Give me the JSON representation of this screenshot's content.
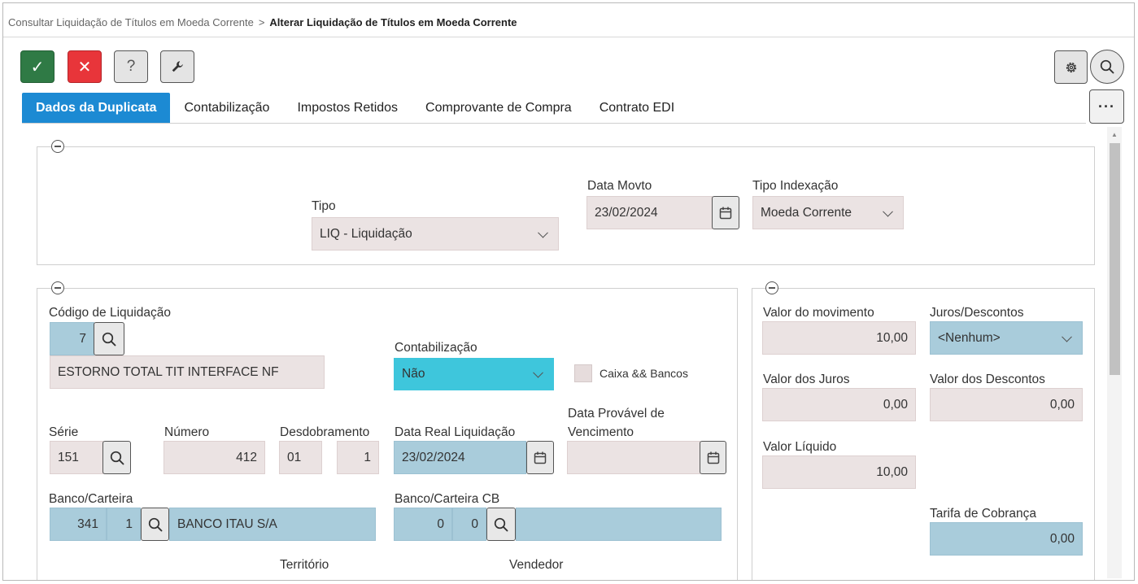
{
  "breadcrumb": {
    "parent": "Consultar Liquidação de Títulos em Moeda Corrente",
    "separator": ">",
    "current": "Alterar Liquidação de Títulos em Moeda Corrente"
  },
  "toolbar": {
    "ok_symbol": "✓",
    "cancel_symbol": "✕",
    "help_symbol": "?",
    "more_symbol": "···"
  },
  "tabs": [
    {
      "label": "Dados da Duplicata",
      "active": true
    },
    {
      "label": "Contabilização"
    },
    {
      "label": "Impostos Retidos"
    },
    {
      "label": "Comprovante de Compra"
    },
    {
      "label": "Contrato EDI"
    }
  ],
  "header": {
    "tipo": {
      "label": "Tipo",
      "value": "LIQ - Liquidação"
    },
    "data_movto": {
      "label": "Data Movto",
      "value": "23/02/2024"
    },
    "tipo_indexacao": {
      "label": "Tipo Indexação",
      "value": "Moeda Corrente"
    }
  },
  "main": {
    "codigo_liquidacao": {
      "label": "Código de Liquidação",
      "value": "7",
      "description": "ESTORNO TOTAL TIT INTERFACE NF"
    },
    "contabilizacao": {
      "label": "Contabilização",
      "value": "Não"
    },
    "caixa_bancos": {
      "label": "Caixa && Bancos",
      "checked": false
    },
    "serie": {
      "label": "Série",
      "value": "151"
    },
    "numero": {
      "label": "Número",
      "value": "412"
    },
    "desdobramento": {
      "label": "Desdobramento",
      "value1": "01",
      "value2": "1"
    },
    "data_real_liquidacao": {
      "label": "Data Real Liquidação",
      "value": "23/02/2024"
    },
    "data_provavel_vencimento": {
      "label_line1": "Data Provável de",
      "label_line2": "Vencimento",
      "value": ""
    },
    "banco_carteira": {
      "label": "Banco/Carteira",
      "banco": "341",
      "carteira": "1",
      "nome": "BANCO ITAU S/A"
    },
    "banco_carteira_cb": {
      "label": "Banco/Carteira CB",
      "banco": "0",
      "carteira": "0",
      "nome": ""
    },
    "territorio": {
      "label": "Território"
    },
    "vendedor": {
      "label": "Vendedor"
    }
  },
  "values": {
    "valor_movimento": {
      "label": "Valor do movimento",
      "value": "10,00"
    },
    "juros_descontos": {
      "label": "Juros/Descontos",
      "value": "<Nenhum>"
    },
    "valor_juros": {
      "label": "Valor dos Juros",
      "value": "0,00"
    },
    "valor_descontos": {
      "label": "Valor dos Descontos",
      "value": "0,00"
    },
    "valor_liquido": {
      "label": "Valor Líquido",
      "value": "10,00"
    },
    "tarifa_cobranca": {
      "label": "Tarifa de Cobrança",
      "value": "0,00"
    }
  },
  "icons": [
    "check-icon",
    "close-icon",
    "help-icon",
    "wrench-icon",
    "gear-icon",
    "search-icon",
    "more-icon",
    "calendar-icon",
    "chevron-down-icon",
    "collapse-icon"
  ],
  "colors": {
    "ok": "#2f7a45",
    "cancel": "#e8353a",
    "tab_active": "#1c8ad3",
    "field_readonly": "#ebe3e3",
    "field_lookup": "#a9ccdb",
    "field_highlight": "#3ec6dc"
  }
}
